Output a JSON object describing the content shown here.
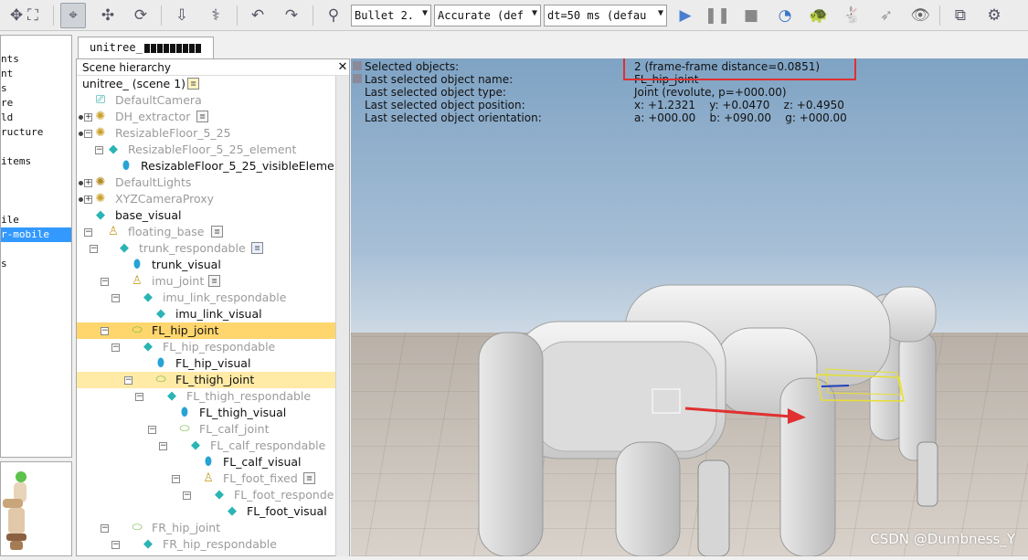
{
  "toolbar": {
    "engine_combo": "Bullet 2.",
    "accuracy_combo": "Accurate (def",
    "timestep_combo": "dt=50 ms (defau"
  },
  "left_strip": {
    "items": [
      "nts",
      "nt",
      "s",
      "re",
      "ld",
      "ructure",
      "items",
      "ile",
      "r-mobile",
      "s"
    ],
    "selected_item": "r-mobile"
  },
  "scene_tab": {
    "label": "unitree_"
  },
  "hierarchy": {
    "title": "Scene hierarchy",
    "close_symbol": "✕",
    "rows": [
      {
        "label": "unitree_ (scene 1)",
        "icon": "scene-icon",
        "gray": false
      },
      {
        "label": "DefaultCamera",
        "icon": "camera-icon",
        "gray": true
      },
      {
        "label": "DH_extractor",
        "icon": "dummy-icon",
        "gray": true
      },
      {
        "label": "ResizableFloor_5_25",
        "icon": "dummy-icon",
        "gray": true
      },
      {
        "label": "ResizableFloor_5_25_element",
        "icon": "cube-icon",
        "gray": true
      },
      {
        "label": "ResizableFloor_5_25_visibleEleme",
        "icon": "shape-icon",
        "gray": false
      },
      {
        "label": "DefaultLights",
        "icon": "light-icon",
        "gray": true
      },
      {
        "label": "XYZCameraProxy",
        "icon": "dummy-icon",
        "gray": true
      },
      {
        "label": "base_visual",
        "icon": "cube-icon",
        "gray": false
      },
      {
        "label": "floating_base",
        "icon": "forcesensor-icon",
        "gray": true
      },
      {
        "label": "trunk_respondable",
        "icon": "cube-icon",
        "gray": true
      },
      {
        "label": "trunk_visual",
        "icon": "shape-icon",
        "gray": false
      },
      {
        "label": "imu_joint",
        "icon": "forcesensor-icon",
        "gray": true
      },
      {
        "label": "imu_link_respondable",
        "icon": "cube-icon",
        "gray": true
      },
      {
        "label": "imu_link_visual",
        "icon": "cube-icon",
        "gray": false
      },
      {
        "label": "FL_hip_joint",
        "icon": "joint-icon",
        "gray": false
      },
      {
        "label": "FL_hip_respondable",
        "icon": "cube-icon",
        "gray": true
      },
      {
        "label": "FL_hip_visual",
        "icon": "shape-icon",
        "gray": false
      },
      {
        "label": "FL_thigh_joint",
        "icon": "joint-icon",
        "gray": false
      },
      {
        "label": "FL_thigh_respondable",
        "icon": "cube-icon",
        "gray": true
      },
      {
        "label": "FL_thigh_visual",
        "icon": "shape-icon",
        "gray": false
      },
      {
        "label": "FL_calf_joint",
        "icon": "joint-icon",
        "gray": true
      },
      {
        "label": "FL_calf_respondable",
        "icon": "cube-icon",
        "gray": true
      },
      {
        "label": "FL_calf_visual",
        "icon": "shape-icon",
        "gray": false
      },
      {
        "label": "FL_foot_fixed",
        "icon": "forcesensor-icon",
        "gray": true
      },
      {
        "label": "FL_foot_responde",
        "icon": "cube-icon",
        "gray": true
      },
      {
        "label": "FL_foot_visual",
        "icon": "cube-icon",
        "gray": false
      },
      {
        "label": "FR_hip_joint",
        "icon": "joint-icon",
        "gray": true
      },
      {
        "label": "FR_hip_respondable",
        "icon": "cube-icon",
        "gray": true
      }
    ]
  },
  "info_overlay": {
    "labels": [
      "Selected objects:",
      "Last selected object name:",
      "Last selected object type:",
      "Last selected object position:",
      "Last selected object orientation:"
    ],
    "values": [
      "2 (frame-frame distance=0.0851)",
      "FL_hip_joint",
      "Joint (revolute, p=+000.00)",
      "x: +1.2321    y: +0.0470    z: +0.4950",
      "a: +000.00    b: +090.00    g: +000.00"
    ]
  },
  "watermark": "CSDN @Dumbness_Y",
  "colors": {
    "selection_highlight": "#ffd66e",
    "secondary_highlight": "#ffeaa6",
    "annotation_red": "#e03030",
    "list_selection": "#3399ff"
  }
}
